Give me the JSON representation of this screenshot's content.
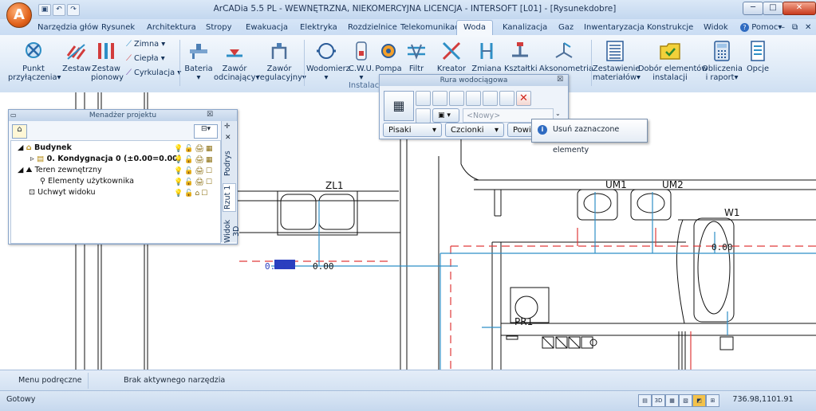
{
  "titlebar": {
    "logo": "A",
    "title": "ArCADia 5.5 PL - WEWNĘTRZNA, NIEKOMERCYJNA LICENCJA - INTERSOFT [L01] - [Rysunekdobre]"
  },
  "quick_access": [
    "save-icon",
    "undo-icon",
    "redo-icon"
  ],
  "menu_tabs": [
    "Narzędzia głów",
    "Rysunek",
    "Architektura",
    "Stropy",
    "Ewakuacja",
    "Elektryka",
    "Rozdzielnice",
    "Telekomunikacj",
    "Woda",
    "Kanalizacja",
    "Gaz",
    "Inwentaryzacja",
    "Konstrukcje",
    "Widok"
  ],
  "active_tab": "Woda",
  "help_label": "Pomoc",
  "ribbon": {
    "punkt": [
      "Punkt",
      "przyłączenia"
    ],
    "zestaw": "Zestaw",
    "zestaw_pionowy": [
      "Zestaw",
      "pionowy"
    ],
    "zimna": "Zimna",
    "ciepla": "Ciepła",
    "cyrkulacja": "Cyrkulacja",
    "bateria": "Bateria",
    "zawor_odcinajacy": [
      "Zawór",
      "odcinający"
    ],
    "zawor_regulacyjny": [
      "Zawór",
      "regulacyjny"
    ],
    "wodomierz": "Wodomierz",
    "cwu": "C.W.U.",
    "pompa": "Pompa",
    "filtr": "Filtr",
    "kreator": "Kreator",
    "zmiana": "Zmiana",
    "ksztaltki": "Kształtki",
    "aksonometria": "Aksonometria",
    "zestawienie": [
      "Zestawienie",
      "materiałów"
    ],
    "dobor": [
      "Dobór elementów",
      "instalacji"
    ],
    "obliczenia": [
      "Obliczenia",
      "i raport"
    ],
    "opcje": "Opcje",
    "group_label": "Instalacja"
  },
  "project_manager": {
    "title": "Menadżer projektu",
    "tree": [
      {
        "label": "Budynek",
        "bold": true
      },
      {
        "label": "0. Kondygnacja 0 (±0.00=0.00)",
        "bold": true
      },
      {
        "label": "Teren zewnętrzny",
        "bold": false
      },
      {
        "label": "Elementy użytkownika",
        "bold": false
      },
      {
        "label": "Uchwyt widoku",
        "bold": false
      }
    ],
    "side_tabs": [
      "Podrys",
      "Rzut 1",
      "Widok 3D"
    ]
  },
  "water_toolbar": {
    "title": "Rura wodociągowa",
    "combo_placeholder": "<Nowy>",
    "pisaki": "Pisaki",
    "czcionki": "Czcionki",
    "powierz": "Powierz"
  },
  "tooltip": {
    "text": "Usuń zaznaczone elementy"
  },
  "drawing": {
    "labels": [
      "ZL1",
      "UM1",
      "UM2",
      "W1",
      "PR1"
    ],
    "elev_text": "0.00",
    "elev_text2": "0.00",
    "elev_text3": "0.00"
  },
  "infobar": {
    "context_menu": "Menu podręczne",
    "tool_status": "Brak aktywnego narzędzia"
  },
  "statusbar": {
    "ready": "Gotowy",
    "coords": "736.98,1101.91"
  },
  "colors": {
    "pipe_red": "#e03a3a",
    "pipe_blue": "#2e8fc6",
    "close_red": "#c8391c"
  }
}
